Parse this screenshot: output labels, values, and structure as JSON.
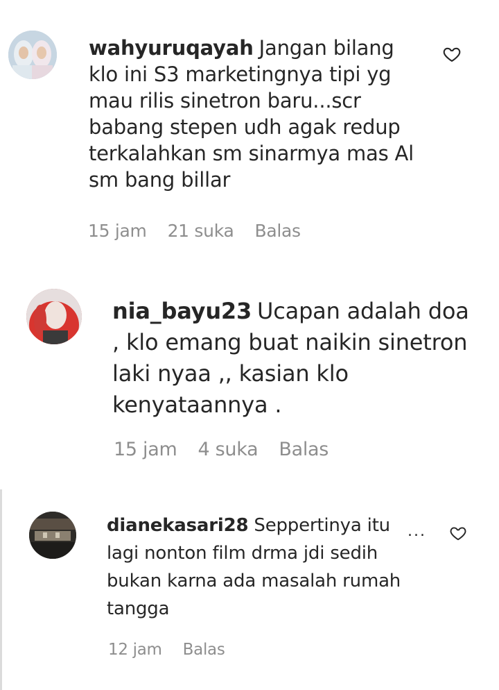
{
  "comments": [
    {
      "username": "wahyuruqayah",
      "text": "Jangan bilang klo ini S3 marketingnya tipi yg mau rilis sinetron baru...scr babang stepen udh agak redup terkalahkan sm sinarmya mas Al sm bang billar",
      "time": "15 jam",
      "likes": "21 suka",
      "reply": "Balas",
      "avatar_icon": "avatar-two-hijab-women"
    },
    {
      "username": "nia_bayu23",
      "text": "Ucapan adalah doa , klo emang buat naikin sinetron laki nyaa ,, kasian klo kenyataannya .",
      "time": "15 jam",
      "likes": "4 suka",
      "reply": "Balas",
      "avatar_icon": "avatar-woman-red-hair"
    },
    {
      "username": "dianekasari28",
      "text": "Seppertinya itu lagi nonton film drma jdi sedih bukan karna ada masalah rumah tangga",
      "time": "12 jam",
      "reply": "Balas",
      "more": "...",
      "avatar_icon": "avatar-dark-room"
    }
  ],
  "icons": {
    "like": "heart-outline-icon",
    "more": "more-options-icon"
  }
}
